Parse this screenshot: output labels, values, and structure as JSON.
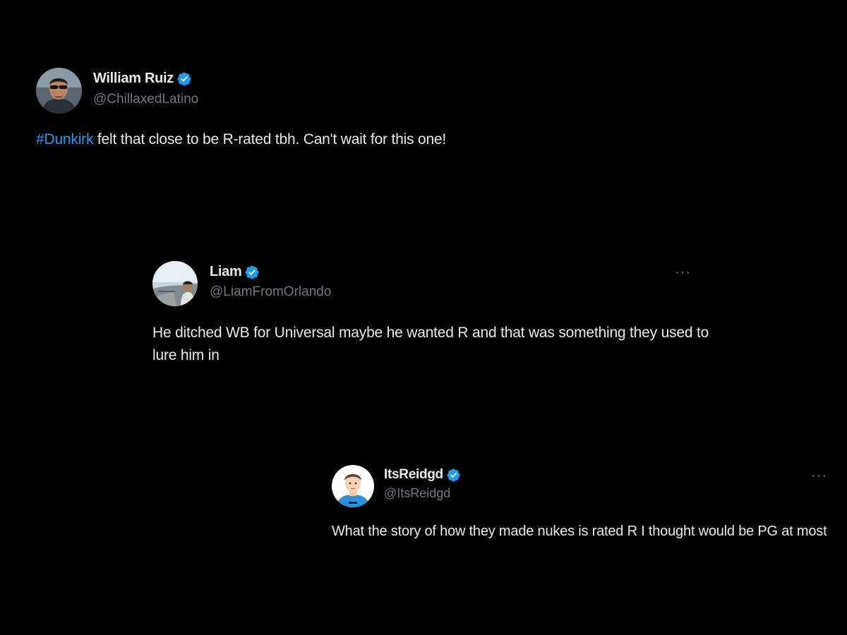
{
  "tweets": [
    {
      "display_name": "William Ruiz",
      "handle": "@ChillaxedLatino",
      "verified": true,
      "hashtag": "#Dunkirk",
      "text": " felt that close to be R-rated tbh. Can't wait for this one!",
      "avatar": "avatar-photo-man-sunglasses"
    },
    {
      "display_name": "Liam",
      "handle": "@LiamFromOrlando",
      "verified": true,
      "text": "He ditched WB for Universal maybe he wanted R and that was something they used to lure him in",
      "more_label": "···",
      "avatar": "avatar-photo-man-outdoors"
    },
    {
      "display_name": "ItsReidgd",
      "handle": "@ItsReidgd",
      "verified": true,
      "text": "What the story of how they made nukes is rated R I thought would be PG at most",
      "more_label": "···",
      "avatar": "avatar-cartoon-man-blue-shirt"
    }
  ],
  "colors": {
    "background": "#000000",
    "text_primary": "#e7e9ea",
    "text_secondary": "#71767b",
    "accent": "#1d9bf0"
  },
  "icons": {
    "verified": "verified-badge-icon",
    "more": "more-options-icon"
  }
}
